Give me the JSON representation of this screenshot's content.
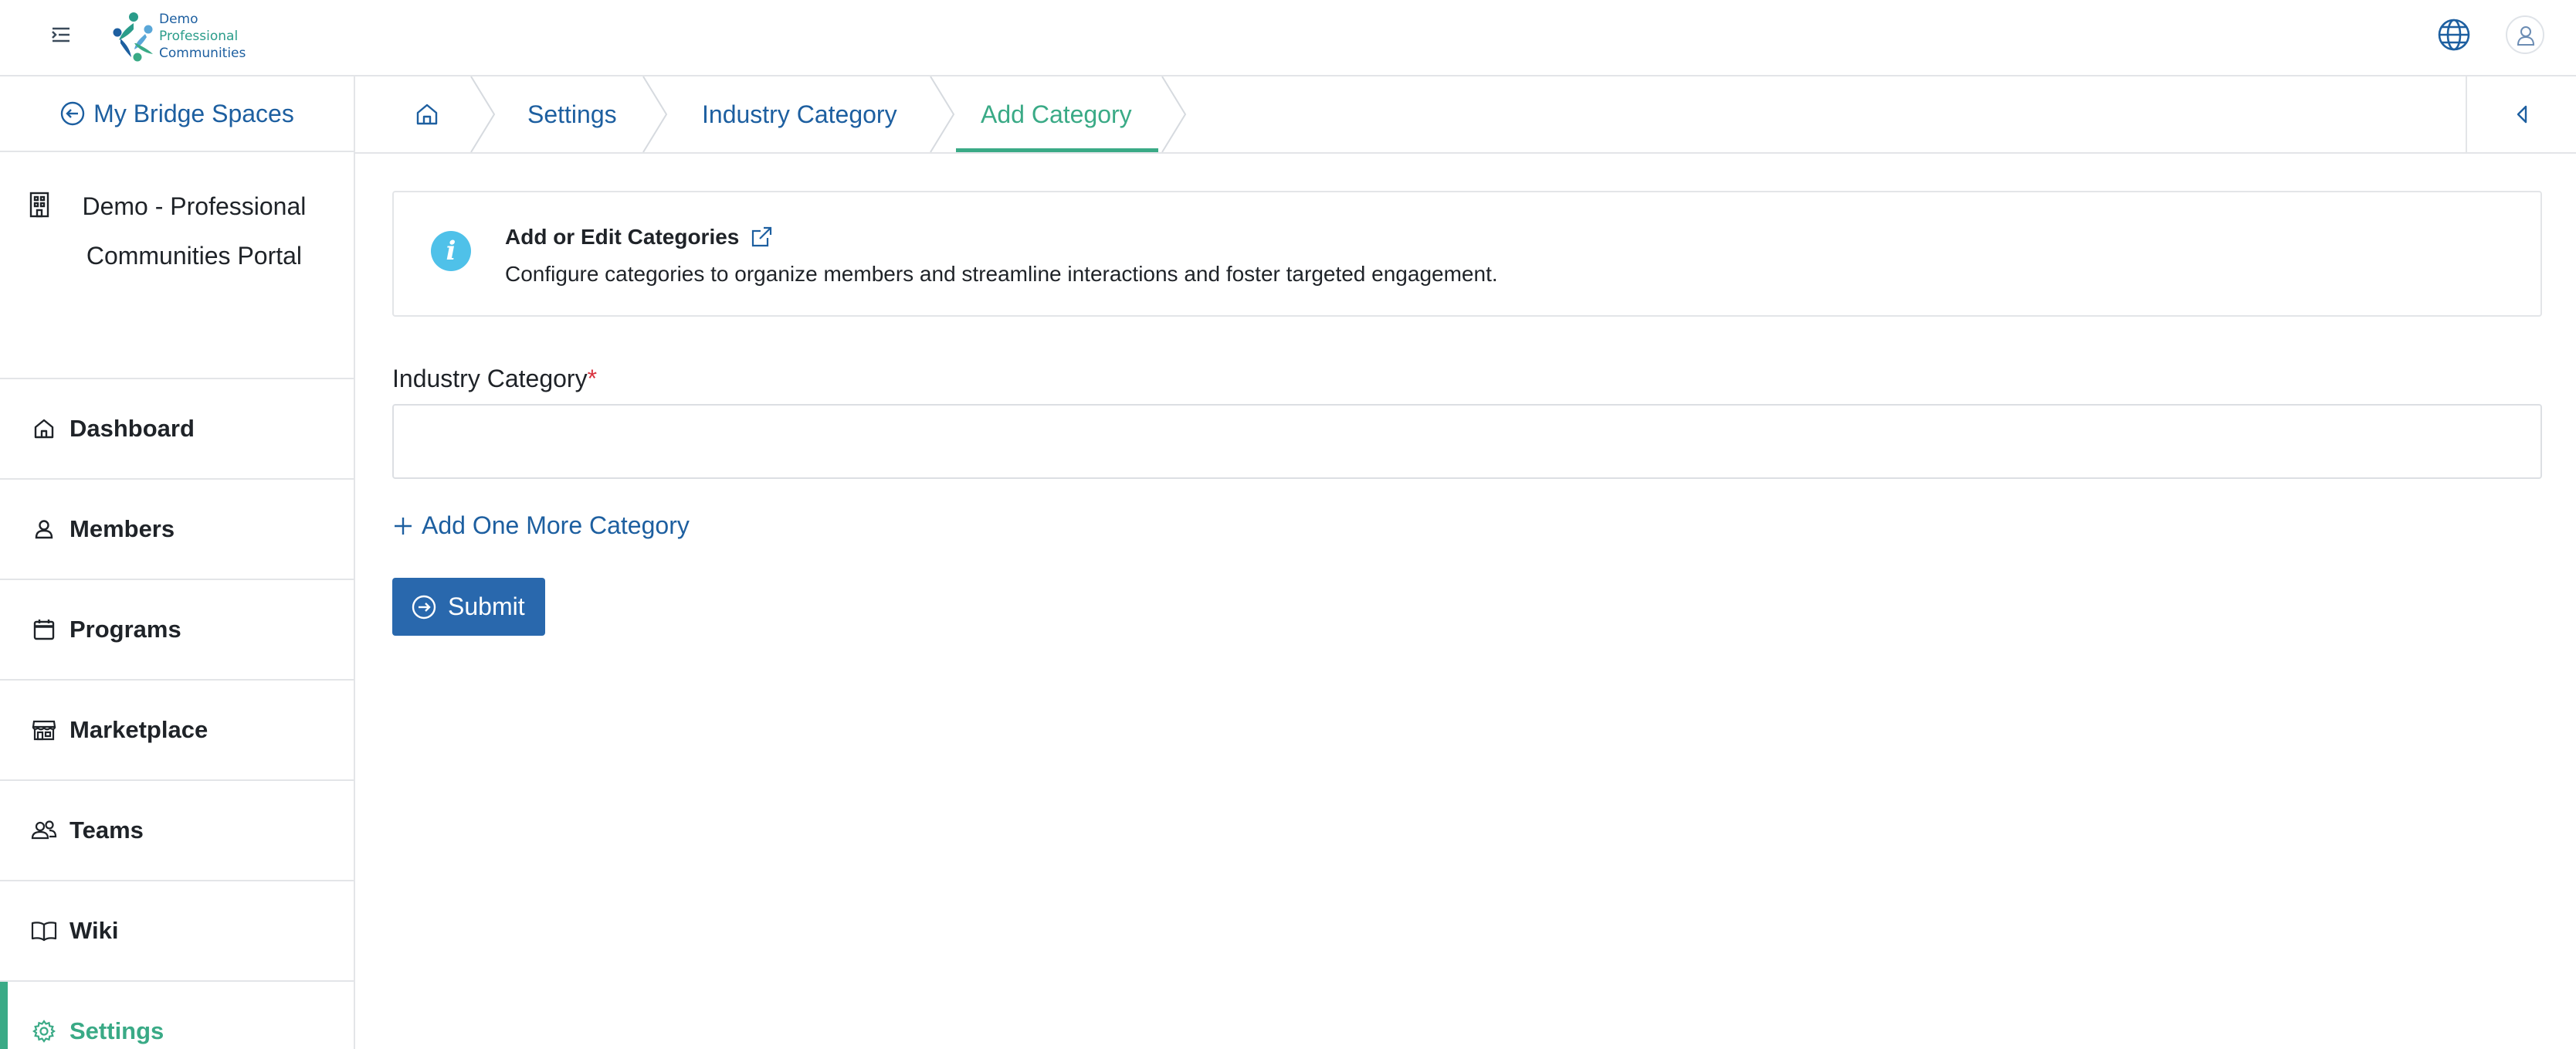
{
  "header": {
    "logo_lines": [
      "Demo",
      "Professional",
      "Communities"
    ]
  },
  "sidebar": {
    "back_label": "My Bridge Spaces",
    "portal_name": "Demo - Professional Communities Portal",
    "items": [
      {
        "label": "Dashboard",
        "icon": "home-icon"
      },
      {
        "label": "Members",
        "icon": "user-icon"
      },
      {
        "label": "Programs",
        "icon": "calendar-icon"
      },
      {
        "label": "Marketplace",
        "icon": "store-icon"
      },
      {
        "label": "Teams",
        "icon": "users-icon"
      },
      {
        "label": "Wiki",
        "icon": "book-icon"
      },
      {
        "label": "Settings",
        "icon": "gear-icon",
        "active": true
      }
    ]
  },
  "breadcrumb": {
    "items": [
      "Settings",
      "Industry Category",
      "Add Category"
    ]
  },
  "info": {
    "title": "Add or Edit Categories",
    "description": "Configure categories to organize members and streamline interactions and foster targeted engagement."
  },
  "form": {
    "field_label": "Industry Category",
    "required_mark": "*",
    "field_value": "",
    "add_more_label": "Add One More Category",
    "submit_label": "Submit"
  },
  "colors": {
    "accent": "#3aaa86",
    "link": "#1d5fa0",
    "button": "#2968ad",
    "info": "#4fc1e9"
  }
}
